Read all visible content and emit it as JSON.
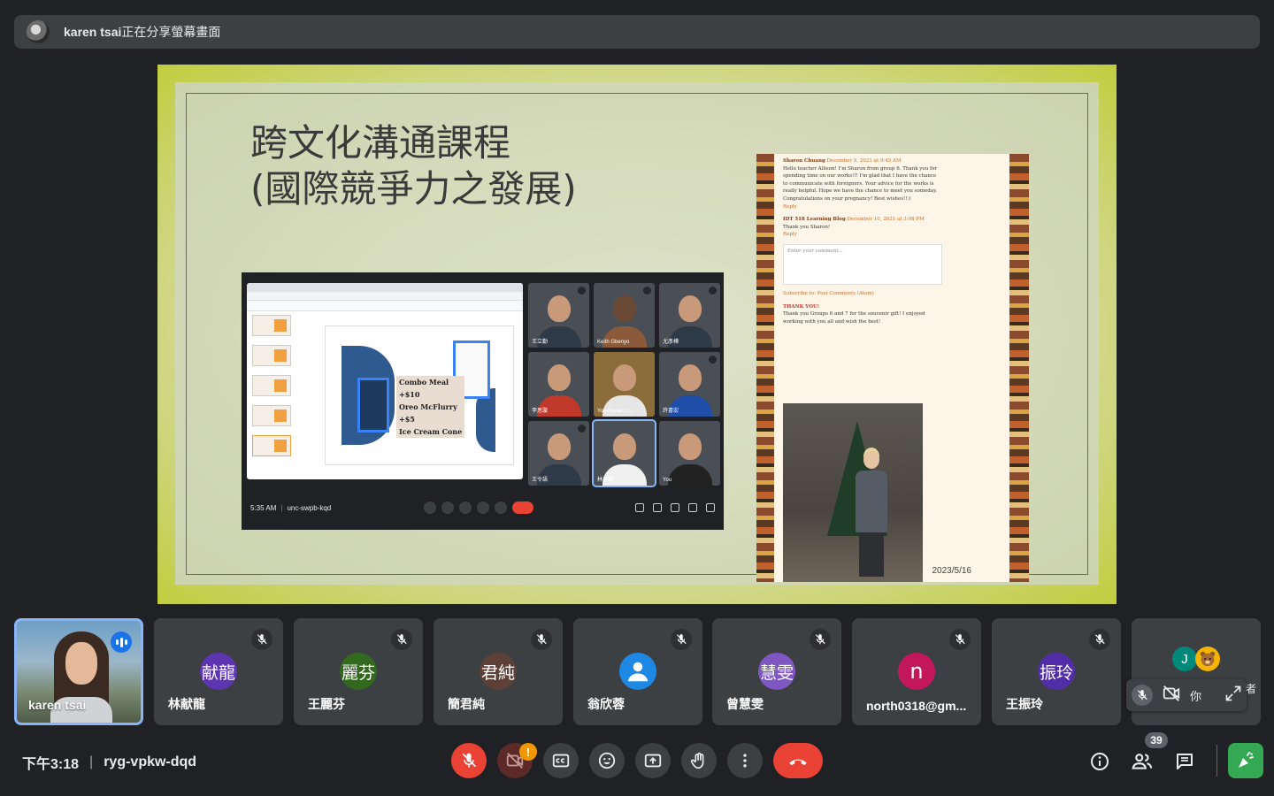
{
  "presenter": {
    "name": "karen tsai",
    "status": "正在分享螢幕畫面"
  },
  "slide": {
    "title_line1": "跨文化溝通課程",
    "title_line2": "(國際競爭力之發展)",
    "date": "2023/5/16"
  },
  "inner_meeting": {
    "time": "5:35 AM",
    "code": "unc-swpb-kqd",
    "menu_lines": [
      "Combo Meal",
      "+$10",
      "Oreo McFlurry",
      "+$5",
      "Ice Cream Cone"
    ],
    "tiles": [
      "王立勤",
      "Keith Gbenyo",
      "尤彥樺",
      "李思璇",
      "You-Hsuan Lu",
      "許書宏",
      "王令語",
      "林芊緣",
      "You"
    ]
  },
  "blog": {
    "c1_author": "Sharon Chuang",
    "c1_date": "December 9, 2021 at 9:45 AM",
    "c1_text": "Hello teacher Allison! I'm Sharon from group 6. Thank you for spending time on our works!!! I'm glad that I have the chance to communicate with foreigners. Your advice for the works is really helpful. Hope we have the chance to meet you someday. Congratulations on your pregnancy! Best wishes!!:)",
    "reply": "Reply",
    "c2_author": "IDT 518 Learning Blog",
    "c2_date": "December 10, 2021 at 3:08 PM",
    "c2_text": "Thank you Sharon!",
    "comment_placeholder": "Enter your comment...",
    "subscribe": "Subscribe to: Post Comments (Atom)",
    "post_title": "THANK YOU!",
    "post_text": "Thank you Groups 6 and 7 for the souvenir gift! I enjoyed working with you all and wish the best!"
  },
  "participants": [
    {
      "name": "karen tsai",
      "self": true
    },
    {
      "name": "林献龍",
      "initials": "献龍",
      "color": "#5e35b1"
    },
    {
      "name": "王麗芬",
      "initials": "麗芬",
      "color": "#33691e"
    },
    {
      "name": "簡君純",
      "initials": "君純",
      "color": "#5d4037"
    },
    {
      "name": "翁欣蓉",
      "initials": "",
      "color": "#1e88e5"
    },
    {
      "name": "曾慧雯",
      "initials": "慧雯",
      "color": "#7e57c2"
    },
    {
      "name": "north0318@gm...",
      "initials": "n",
      "color": "#c2185b"
    },
    {
      "name": "王振玲",
      "initials": "振玲",
      "color": "#512da8"
    }
  ],
  "more_tile": {
    "initial": "J",
    "you_label": "你",
    "peek": "者"
  },
  "bottom": {
    "time": "下午3:18",
    "meeting_code": "ryg-vpkw-dqd",
    "people_count": "39",
    "warning": "!"
  },
  "colors": {
    "accent": "#8ab4f8",
    "red": "#ea4335",
    "green": "#34a853",
    "tile": "#3c4043",
    "bg": "#202124"
  }
}
